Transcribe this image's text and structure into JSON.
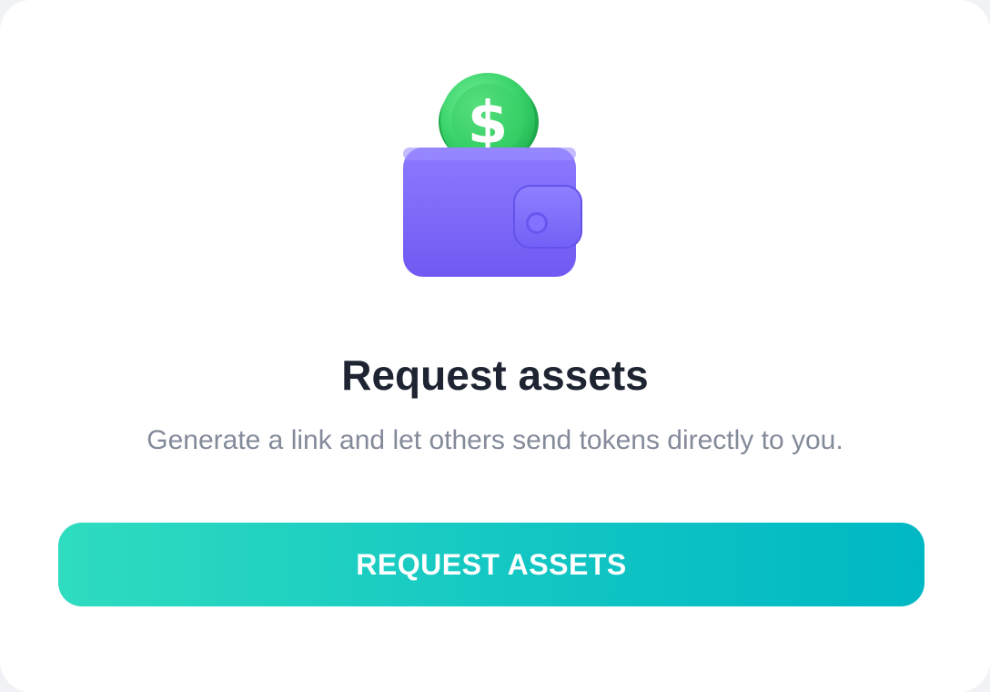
{
  "card": {
    "title": "Request assets",
    "subtitle": "Generate a link and let others send tokens directly to you.",
    "illustration_icon": "wallet-with-dollar-coin-icon",
    "coin_symbol": "$"
  },
  "actions": {
    "request_label": "REQUEST ASSETS"
  },
  "colors": {
    "title": "#1e2432",
    "subtitle": "#838a99",
    "button_gradient_start": "#2fdcbf",
    "button_gradient_end": "#00b8c4",
    "wallet": "#7e6bff",
    "coin": "#34d46a"
  }
}
